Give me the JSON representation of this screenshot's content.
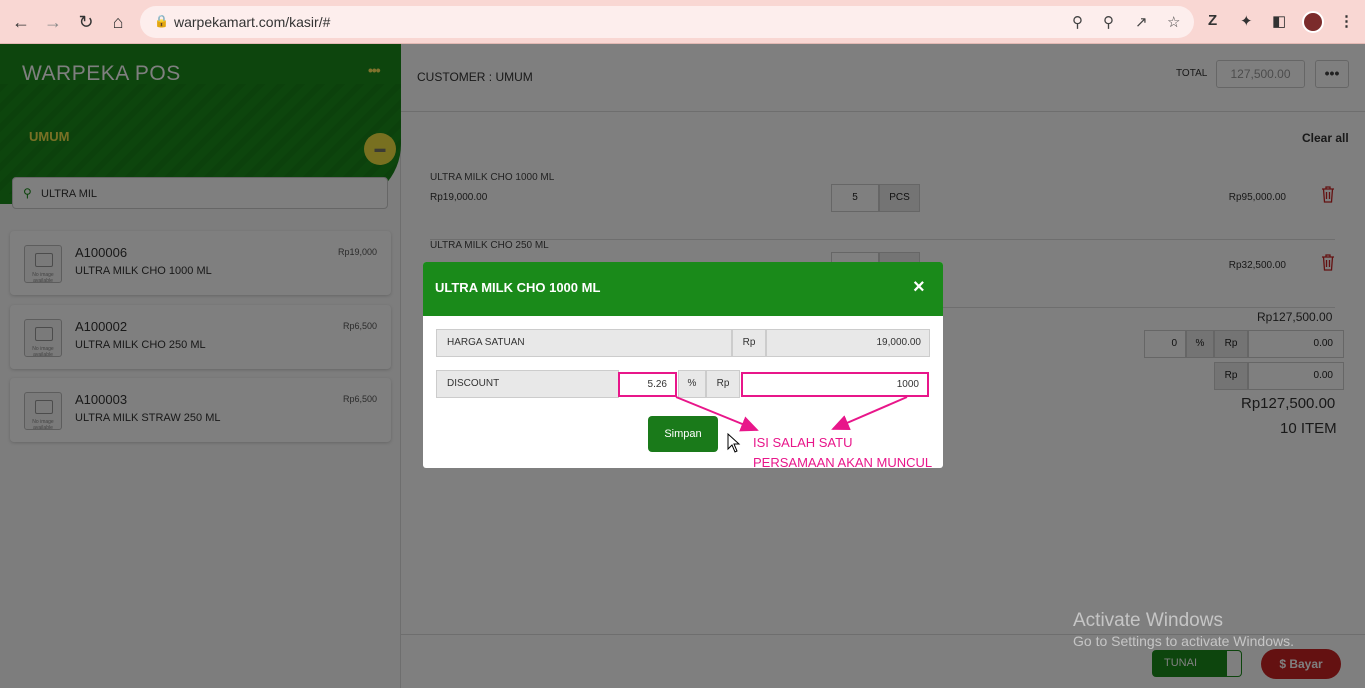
{
  "browser": {
    "url": "warpekamart.com/kasir/#"
  },
  "sidebar": {
    "brand": "WARPEKA POS",
    "menu_dots": "•••",
    "customer_name": "UMUM",
    "search": {
      "value": "ULTRA MIL"
    },
    "products": [
      {
        "code": "A100006",
        "name": "ULTRA MILK CHO 1000 ML",
        "price": "Rp19,000",
        "thumb": "No image available"
      },
      {
        "code": "A100002",
        "name": "ULTRA MILK CHO 250 ML",
        "price": "Rp6,500",
        "thumb": "No image available"
      },
      {
        "code": "A100003",
        "name": "ULTRA MILK STRAW 250 ML",
        "price": "Rp6,500",
        "thumb": "No image available"
      }
    ]
  },
  "main": {
    "customer_label": "CUSTOMER : UMUM",
    "total_label": "TOTAL",
    "total_value": "127,500.00",
    "more": "•••",
    "clear_all": "Clear all",
    "cart": [
      {
        "name": "ULTRA MILK CHO 1000 ML",
        "price": "Rp19,000.00",
        "qty": "5",
        "unit": "PCS",
        "subtotal": "Rp95,000.00"
      },
      {
        "name": "ULTRA MILK CHO 250 ML",
        "price": "",
        "qty": "",
        "unit": "",
        "subtotal": "Rp32,500.00"
      }
    ],
    "summary": {
      "subtotal": "Rp127,500.00",
      "disc_pct": "0",
      "pct_sign": "%",
      "rp": "Rp",
      "disc_rp": "0.00",
      "other_rp": "0.00",
      "grand_total": "Rp127,500.00",
      "items": "10 ITEM"
    },
    "footer": {
      "payment_method": "TUNAI",
      "pay_button": "$ Bayar"
    }
  },
  "modal": {
    "title": "ULTRA MILK CHO 1000 ML",
    "close": "×",
    "unit_price_label": "HARGA SATUAN",
    "rp": "Rp",
    "unit_price": "19,000.00",
    "discount_label": "DISCOUNT",
    "discount_pct": "5.26",
    "pct_sign": "%",
    "discount_rp": "1000",
    "save": "Simpan"
  },
  "annotation": {
    "line1": "ISI SALAH SATU",
    "line2": "PERSAMAAN AKAN MUNCUL",
    "color": "#e8168a"
  },
  "watermark": {
    "title": "Activate Windows",
    "subtitle": "Go to Settings to activate Windows."
  },
  "colors": {
    "brand_green": "#1a8a1a",
    "accent_yellow": "#f0e040",
    "pay_red": "#c82323"
  }
}
